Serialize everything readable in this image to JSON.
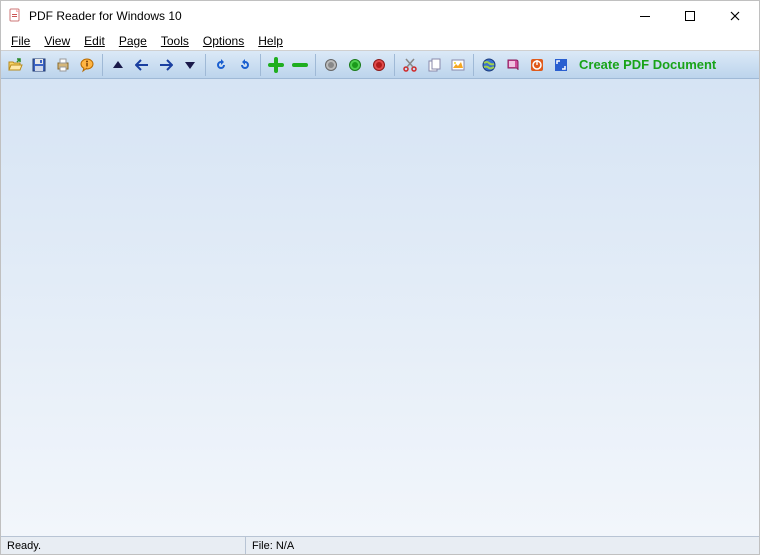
{
  "titlebar": {
    "title": "PDF Reader for Windows 10"
  },
  "menubar": {
    "items": [
      {
        "label": "File",
        "hotkey_index": 0
      },
      {
        "label": "View",
        "hotkey_index": 0
      },
      {
        "label": "Edit",
        "hotkey_index": 0
      },
      {
        "label": "Page",
        "hotkey_index": 0
      },
      {
        "label": "Tools",
        "hotkey_index": 0
      },
      {
        "label": "Options",
        "hotkey_index": 0
      },
      {
        "label": "Help",
        "hotkey_index": 0
      }
    ]
  },
  "toolbar": {
    "create_label": "Create PDF Document"
  },
  "statusbar": {
    "ready": "Ready.",
    "file": "File: N/A"
  }
}
